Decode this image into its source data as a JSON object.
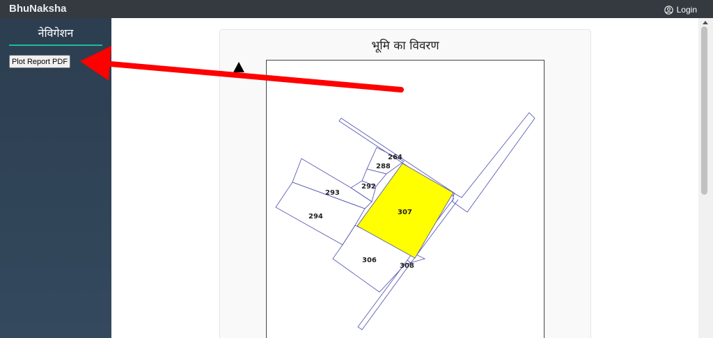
{
  "header": {
    "brand": "BhuNaksha",
    "login_label": "Login"
  },
  "sidebar": {
    "title": "नेविगेशन",
    "report_button_label": "Plot Report PDF"
  },
  "main": {
    "card_title": "भूमि का विवरण",
    "plots": [
      {
        "id": "264",
        "selected": false
      },
      {
        "id": "288",
        "selected": false
      },
      {
        "id": "292",
        "selected": false
      },
      {
        "id": "293",
        "selected": false
      },
      {
        "id": "294",
        "selected": false
      },
      {
        "id": "307",
        "selected": true
      },
      {
        "id": "306",
        "selected": false
      },
      {
        "id": "308",
        "selected": false
      }
    ]
  },
  "colors": {
    "topbar": "#343a40",
    "sidebar": "#2c3e50",
    "accent_line": "#1abc9c",
    "selected_plot": "#ffff00",
    "plot_outline": "#5b5bb5",
    "arrow": "#ff0000"
  },
  "icons": {
    "login": "user-circle-icon",
    "north": "north-arrow-icon"
  }
}
